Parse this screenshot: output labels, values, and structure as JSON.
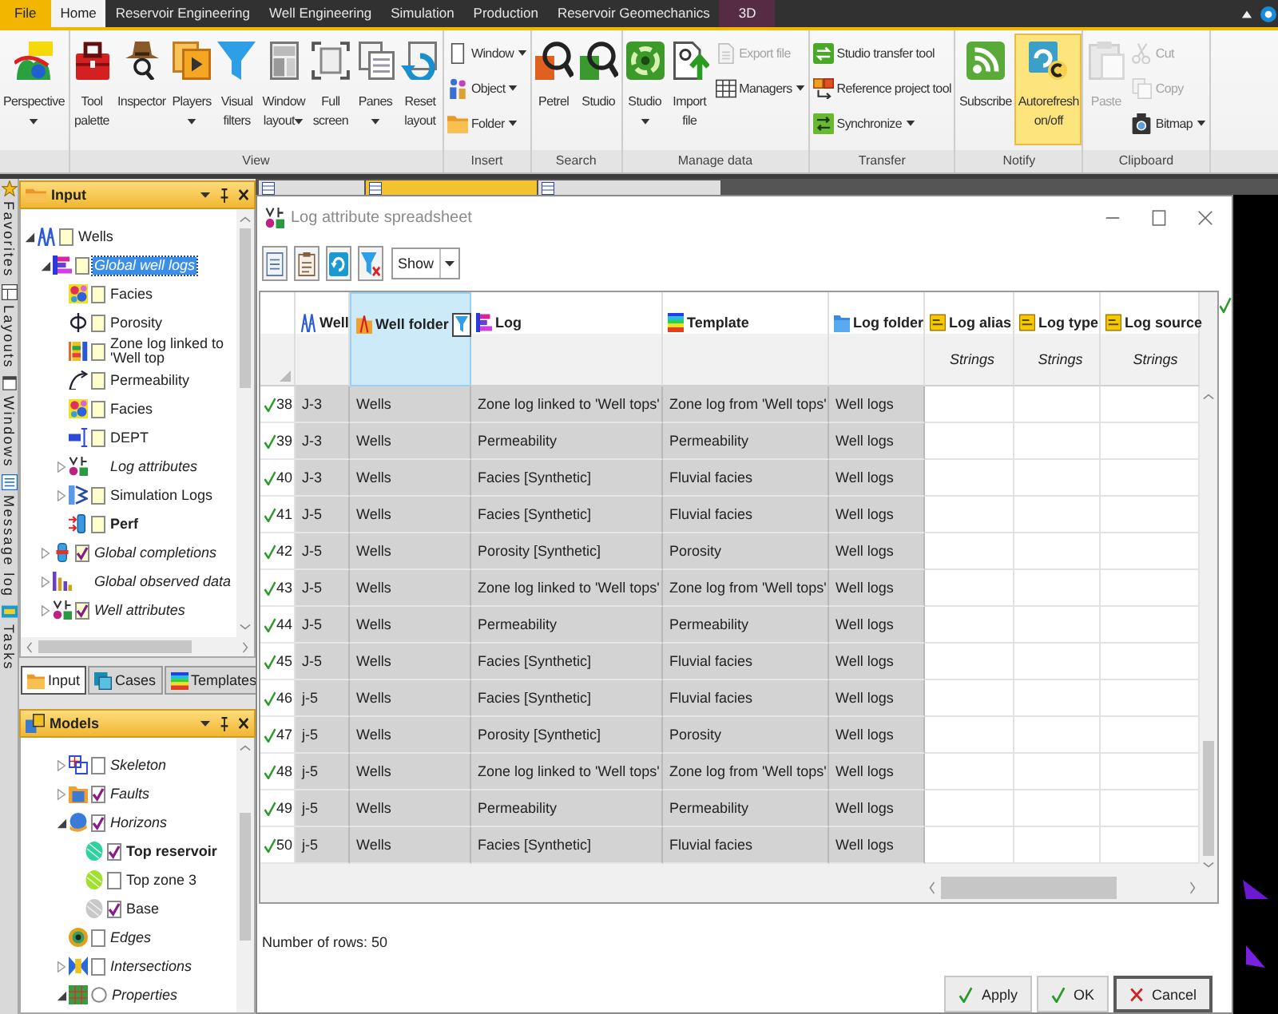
{
  "tabs": [
    {
      "label": "File",
      "kind": "file",
      "selected": false
    },
    {
      "label": "Home",
      "kind": "tab",
      "selected": true
    },
    {
      "label": "Reservoir Engineering",
      "kind": "tab",
      "selected": false
    },
    {
      "label": "Well Engineering",
      "kind": "tab",
      "selected": false
    },
    {
      "label": "Simulation",
      "kind": "tab",
      "selected": false
    },
    {
      "label": "Production",
      "kind": "tab",
      "selected": false
    },
    {
      "label": "Reservoir Geomechanics",
      "kind": "tab",
      "selected": false
    },
    {
      "label": "3D",
      "kind": "context",
      "selected": false
    }
  ],
  "ribbon": {
    "groups": [
      {
        "buttons": [
          {
            "label": "Perspective",
            "kind": "large",
            "dropdown": true,
            "disabled": false,
            "on": false
          }
        ]
      },
      {
        "label": "View",
        "buttons": [
          {
            "label": "Tool\npalette",
            "kind": "large",
            "dropdown": false,
            "disabled": false,
            "on": false
          },
          {
            "label": "Inspector",
            "kind": "large",
            "dropdown": false,
            "disabled": false,
            "on": false
          },
          {
            "label": "Players",
            "kind": "large",
            "dropdown": true,
            "disabled": false,
            "on": false
          },
          {
            "label": "Visual\nfilters",
            "kind": "large",
            "dropdown": false,
            "disabled": false,
            "on": false
          },
          {
            "label": "Window\nlayout",
            "kind": "large",
            "dropdown": true,
            "disabled": false,
            "on": false
          },
          {
            "label": "Full\nscreen",
            "kind": "large",
            "dropdown": false,
            "disabled": false,
            "on": false
          },
          {
            "label": "Panes",
            "kind": "large",
            "dropdown": true,
            "disabled": false,
            "on": false
          },
          {
            "label": "Reset\nlayout",
            "kind": "large",
            "dropdown": false,
            "disabled": false,
            "on": false
          }
        ]
      },
      {
        "label": "Insert",
        "buttons": [
          {
            "label": "Window",
            "kind": "small",
            "dropdown": true,
            "disabled": false,
            "on": false
          },
          {
            "label": "Object",
            "kind": "small",
            "dropdown": true,
            "disabled": false,
            "on": false
          },
          {
            "label": "Folder",
            "kind": "small",
            "dropdown": true,
            "disabled": false,
            "on": false
          }
        ]
      },
      {
        "label": "Search",
        "buttons": [
          {
            "label": "Petrel",
            "kind": "large",
            "dropdown": false,
            "disabled": false,
            "on": false
          },
          {
            "label": "Studio",
            "kind": "large",
            "dropdown": false,
            "disabled": false,
            "on": false
          }
        ]
      },
      {
        "label": "Manage data",
        "buttons": [
          {
            "label": "Studio",
            "kind": "large",
            "dropdown": true,
            "disabled": false,
            "on": false
          },
          {
            "label": "Import\nfile",
            "kind": "large",
            "dropdown": false,
            "disabled": false,
            "on": false
          },
          {
            "label": "Export file",
            "kind": "small",
            "dropdown": false,
            "disabled": true,
            "on": false
          },
          {
            "label": "Managers",
            "kind": "small",
            "dropdown": true,
            "disabled": false,
            "on": false
          }
        ]
      },
      {
        "label": "Transfer",
        "buttons": [
          {
            "label": "Studio transfer tool",
            "kind": "small",
            "dropdown": false,
            "disabled": false,
            "on": false
          },
          {
            "label": "Reference project tool",
            "kind": "small",
            "dropdown": false,
            "disabled": false,
            "on": false
          },
          {
            "label": "Synchronize",
            "kind": "small",
            "dropdown": true,
            "disabled": false,
            "on": false
          }
        ]
      },
      {
        "label": "Notify",
        "buttons": [
          {
            "label": "Subscribe",
            "kind": "large",
            "dropdown": false,
            "disabled": false,
            "on": false
          },
          {
            "label": "Autorefresh\non/off",
            "kind": "large",
            "dropdown": false,
            "disabled": false,
            "on": true
          }
        ]
      },
      {
        "label": "Clipboard",
        "buttons": [
          {
            "label": "Paste",
            "kind": "large",
            "dropdown": false,
            "disabled": true,
            "on": false
          },
          {
            "label": "Cut",
            "kind": "small",
            "dropdown": false,
            "disabled": true,
            "on": false
          },
          {
            "label": "Copy",
            "kind": "small",
            "dropdown": false,
            "disabled": true,
            "on": false
          },
          {
            "label": "Bitmap",
            "kind": "small",
            "dropdown": true,
            "disabled": false,
            "on": false
          }
        ]
      }
    ]
  },
  "side_tabs": [
    {
      "label": "Favorites"
    },
    {
      "label": "Layouts"
    },
    {
      "label": "Windows"
    },
    {
      "label": "Message log"
    },
    {
      "label": "Tasks"
    }
  ],
  "input_panel": {
    "title": "Input",
    "tree": [
      {
        "label": "Wells",
        "kind": "object",
        "checked": false,
        "active": false,
        "selected": false,
        "expanded": true,
        "children": [
          {
            "label": "Global well logs",
            "kind": "folder",
            "checked": false,
            "active": false,
            "selected": true,
            "expanded": true,
            "children": [
              {
                "label": "Facies",
                "kind": "object",
                "checked": false,
                "active": false,
                "selected": false
              },
              {
                "label": "Porosity",
                "kind": "object",
                "checked": false,
                "active": false,
                "selected": false
              },
              {
                "label": "Zone log linked to 'Well top",
                "kind": "object",
                "checked": false,
                "active": false,
                "selected": false
              },
              {
                "label": "Permeability",
                "kind": "object",
                "checked": false,
                "active": false,
                "selected": false
              },
              {
                "label": "Facies",
                "kind": "object",
                "checked": false,
                "active": false,
                "selected": false
              },
              {
                "label": "DEPT",
                "kind": "object",
                "checked": false,
                "active": false,
                "selected": false
              },
              {
                "label": "Log attributes",
                "kind": "category",
                "active": false,
                "selected": false,
                "expanded": false
              },
              {
                "label": "Simulation Logs",
                "kind": "object",
                "checked": false,
                "active": false,
                "selected": false,
                "expanded": false
              },
              {
                "label": "Perf",
                "kind": "object",
                "checked": false,
                "active": true,
                "selected": false
              }
            ]
          },
          {
            "label": "Global completions",
            "kind": "folder",
            "checked": true,
            "active": false,
            "selected": false,
            "expanded": false
          },
          {
            "label": "Global observed data",
            "kind": "category",
            "active": false,
            "selected": false,
            "expanded": false
          },
          {
            "label": "Well attributes",
            "kind": "folder",
            "checked": true,
            "active": false,
            "selected": false,
            "expanded": false
          }
        ]
      }
    ],
    "tabs": [
      {
        "label": "Input",
        "selected": true
      },
      {
        "label": "Cases",
        "selected": false
      },
      {
        "label": "Templates",
        "selected": false
      }
    ]
  },
  "models_panel": {
    "title": "Models",
    "tree": [
      {
        "label": "Skeleton",
        "kind": "folder",
        "checked": false,
        "active": false,
        "selected": false,
        "expanded": false
      },
      {
        "label": "Faults",
        "kind": "folder",
        "checked": true,
        "active": false,
        "selected": false,
        "expanded": false
      },
      {
        "label": "Horizons",
        "kind": "folder",
        "checked": true,
        "active": false,
        "selected": false,
        "expanded": true,
        "children": [
          {
            "label": "Top reservoir",
            "kind": "object",
            "checked": true,
            "active": true,
            "selected": false
          },
          {
            "label": "Top zone 3",
            "kind": "object",
            "checked": false,
            "active": false,
            "selected": false
          },
          {
            "label": "Base",
            "kind": "object",
            "checked": true,
            "active": false,
            "selected": false
          }
        ]
      },
      {
        "label": "Edges",
        "kind": "folder",
        "checked": false,
        "active": false,
        "selected": false
      },
      {
        "label": "Intersections",
        "kind": "folder",
        "checked": false,
        "active": false,
        "selected": false,
        "expanded": false
      },
      {
        "label": "Properties",
        "kind": "selector",
        "checked": false,
        "active": false,
        "selected": false,
        "expanded": true
      }
    ]
  },
  "document_tabs": [
    {
      "selected": false
    },
    {
      "selected": true
    },
    {
      "selected": false
    }
  ],
  "dialog": {
    "title": "Log attribute spreadsheet",
    "toolbar": {
      "show_dropdown": "Show"
    },
    "columns": [
      {
        "label": "Well",
        "read_only": true,
        "selected": false
      },
      {
        "label": "Well folder",
        "read_only": true,
        "selected": true
      },
      {
        "label": "Log",
        "read_only": true,
        "selected": false
      },
      {
        "label": "Template",
        "read_only": true,
        "selected": false
      },
      {
        "label": "Log folder",
        "read_only": true,
        "selected": false
      },
      {
        "label": "Log alias",
        "subtitle": "Strings",
        "read_only": false,
        "selected": false
      },
      {
        "label": "Log type",
        "subtitle": "Strings",
        "read_only": false,
        "selected": false
      },
      {
        "label": "Log source",
        "subtitle": "Strings",
        "read_only": false,
        "selected": false
      }
    ],
    "rows": [
      {
        "number": "38",
        "valid": true,
        "cells": [
          "J-3",
          "Wells",
          "Zone log linked to 'Well tops'",
          "Zone log from 'Well tops'",
          "Well logs"
        ]
      },
      {
        "number": "39",
        "valid": true,
        "cells": [
          "J-3",
          "Wells",
          "Permeability",
          "Permeability",
          "Well logs"
        ]
      },
      {
        "number": "40",
        "valid": true,
        "cells": [
          "J-3",
          "Wells",
          "Facies [Synthetic]",
          "Fluvial facies",
          "Well logs"
        ]
      },
      {
        "number": "41",
        "valid": true,
        "cells": [
          "J-5",
          "Wells",
          "Facies [Synthetic]",
          "Fluvial facies",
          "Well logs"
        ]
      },
      {
        "number": "42",
        "valid": true,
        "cells": [
          "J-5",
          "Wells",
          "Porosity [Synthetic]",
          "Porosity",
          "Well logs"
        ]
      },
      {
        "number": "43",
        "valid": true,
        "cells": [
          "J-5",
          "Wells",
          "Zone log linked to 'Well tops'",
          "Zone log from 'Well tops'",
          "Well logs"
        ]
      },
      {
        "number": "44",
        "valid": true,
        "cells": [
          "J-5",
          "Wells",
          "Permeability",
          "Permeability",
          "Well logs"
        ]
      },
      {
        "number": "45",
        "valid": true,
        "cells": [
          "J-5",
          "Wells",
          "Facies [Synthetic]",
          "Fluvial facies",
          "Well logs"
        ]
      },
      {
        "number": "46",
        "valid": true,
        "cells": [
          "j-5",
          "Wells",
          "Facies [Synthetic]",
          "Fluvial facies",
          "Well logs"
        ]
      },
      {
        "number": "47",
        "valid": true,
        "cells": [
          "j-5",
          "Wells",
          "Porosity [Synthetic]",
          "Porosity",
          "Well logs"
        ]
      },
      {
        "number": "48",
        "valid": true,
        "cells": [
          "j-5",
          "Wells",
          "Zone log linked to 'Well tops'",
          "Zone log from 'Well tops'",
          "Well logs"
        ]
      },
      {
        "number": "49",
        "valid": true,
        "cells": [
          "j-5",
          "Wells",
          "Permeability",
          "Permeability",
          "Well logs"
        ]
      },
      {
        "number": "50",
        "valid": true,
        "cells": [
          "j-5",
          "Wells",
          "Facies [Synthetic]",
          "Fluvial facies",
          "Well logs"
        ]
      }
    ],
    "row_count": "Number of rows: 50",
    "buttons": [
      {
        "label": "Apply",
        "focused": false
      },
      {
        "label": "OK",
        "focused": false
      },
      {
        "label": "Cancel",
        "focused": true
      }
    ]
  }
}
